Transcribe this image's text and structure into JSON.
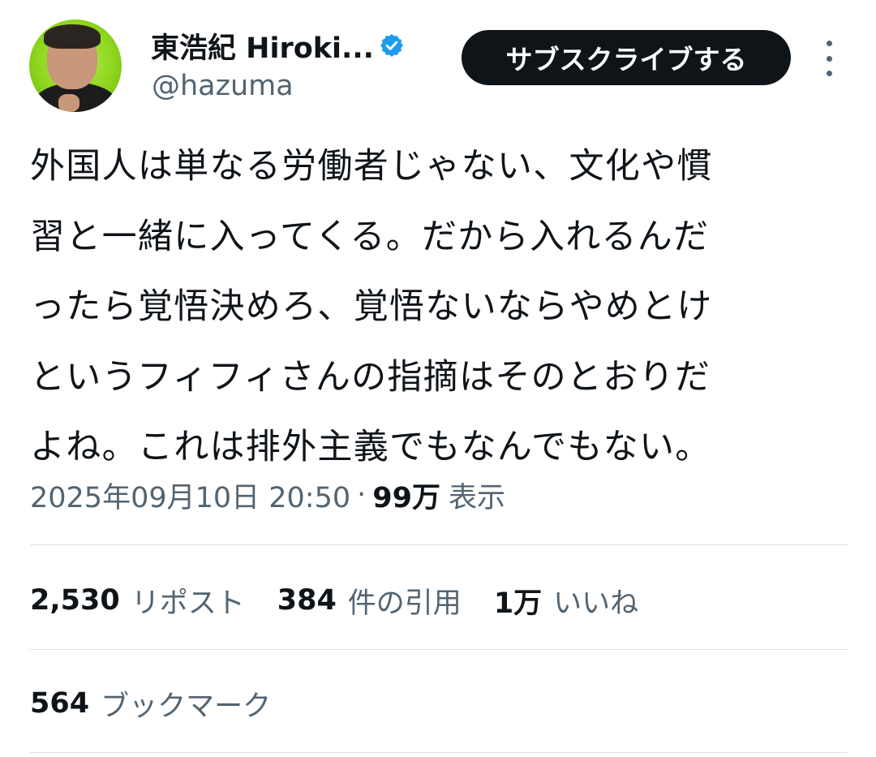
{
  "author": {
    "display_name": "東浩紀 Hiroki...",
    "handle": "@hazuma",
    "verified_icon": "verified-badge-icon",
    "avatar_icon": "avatar"
  },
  "actions": {
    "subscribe_label": "サブスクライブする",
    "more_icon": "more-vertical-icon"
  },
  "tweet": {
    "lines": [
      "外国人は単なる労働者じゃない、文化や慣",
      "習と一緒に入ってくる。だから入れるんだ",
      "ったら覚悟決めろ、覚悟ないならやめとけ",
      "というフィフィさんの指摘はそのとおりだ",
      "よね。これは排外主義でもなんでもない。"
    ]
  },
  "meta": {
    "timestamp": "2025年09月10日 20:50",
    "separator": "·",
    "views_count": "99万",
    "views_label": "表示"
  },
  "stats": {
    "reposts": {
      "count": "2,530",
      "label": "リポスト"
    },
    "quotes": {
      "count": "384",
      "label": "件の引用"
    },
    "likes": {
      "count": "1万",
      "label": "いいね"
    },
    "bookmarks": {
      "count": "564",
      "label": "ブックマーク"
    }
  },
  "colors": {
    "text_primary": "#0f1419",
    "text_secondary": "#536471",
    "verified_blue": "#1d9bf0",
    "button_bg": "#0f1419",
    "divider": "#dfe3e6"
  }
}
